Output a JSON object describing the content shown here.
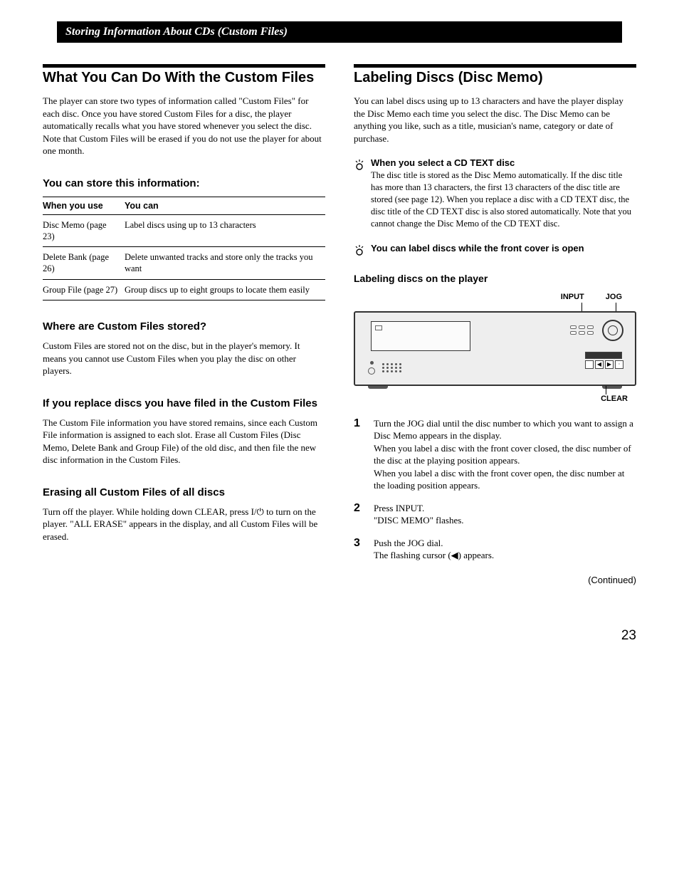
{
  "chapter_title": "Storing Information About CDs (Custom Files)",
  "left": {
    "heading": "What You Can Do With the Custom Files",
    "intro": "The player can store two types of information called \"Custom Files\" for each disc. Once you have stored Custom Files for a disc, the player automatically recalls what you have stored whenever you select the disc. Note that Custom Files will be erased if you do not use the player for about one month.",
    "store_heading": "You can store this information:",
    "table": {
      "head_use": "When you use",
      "head_can": "You can",
      "rows": [
        {
          "use": "Disc Memo (page 23)",
          "can": "Label discs using up to 13 characters"
        },
        {
          "use": "Delete Bank (page 26)",
          "can": "Delete unwanted tracks and store only the tracks you want"
        },
        {
          "use": "Group File (page 27)",
          "can": "Group discs up to eight groups to locate them easily"
        }
      ]
    },
    "where_heading": "Where are Custom Files stored?",
    "where_body": "Custom Files are stored not on the disc, but in the player's memory. It means you cannot use Custom Files when you play the disc on other players.",
    "replace_heading": "If you replace discs you have filed in the Custom Files",
    "replace_body": "The Custom File information you have stored remains, since each Custom File information is assigned to each slot. Erase all Custom Files (Disc Memo, Delete Bank and Group File) of the old disc, and then file the new disc information in the Custom Files.",
    "erase_heading": "Erasing all Custom Files of all discs",
    "erase_body": "Turn off the player. While holding down CLEAR, press I/⏻ to turn on the player. \"ALL ERASE\" appears in the display, and all Custom Files will be erased."
  },
  "right": {
    "heading": "Labeling Discs (Disc Memo)",
    "intro": "You can label discs using up to 13 characters and have the player display the Disc Memo each time you select the disc. The Disc Memo can be anything you like, such as a title, musician's name, category or date of purchase.",
    "tip1_title": "When you select a CD TEXT disc",
    "tip1_body": "The disc title is stored as the Disc Memo automatically. If the disc title has more than 13 characters, the first 13 characters of the disc title are stored (see page 12). When you replace a disc with a CD TEXT disc, the disc title of the CD TEXT disc is also stored automatically. Note that you cannot change the Disc Memo of the CD TEXT disc.",
    "tip2_title": "You can label discs while the front cover is open",
    "labeling_heading": "Labeling discs on the player",
    "figure": {
      "label_input": "INPUT",
      "label_jog": "JOG",
      "label_clear": "CLEAR"
    },
    "steps": [
      {
        "num": "1",
        "body": "Turn the JOG dial until the disc number to which you want to assign a Disc Memo appears in the display.\nWhen you label a disc with the front cover closed, the disc number of the disc at the playing position appears.\nWhen you label a disc with the front cover open, the disc number at the loading position appears."
      },
      {
        "num": "2",
        "body": "Press INPUT.\n\"DISC MEMO\" flashes."
      },
      {
        "num": "3",
        "body": "Push the JOG dial.\nThe flashing cursor (◀) appears."
      }
    ],
    "continued": "(Continued)"
  },
  "page_number": "23"
}
